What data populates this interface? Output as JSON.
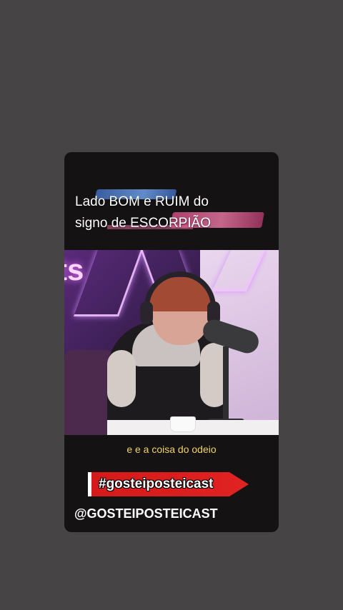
{
  "story": {
    "title_line1": "Lado BOM e RUIM do",
    "title_line2": "signo de ESCORPIÃO",
    "subtitle": "e e a coisa do odeio",
    "hashtag": "#gosteiposteicast",
    "handle": "@GOSTEIPOSTEICAST"
  },
  "colors": {
    "page_bg": "#474446",
    "card_bg": "#141213",
    "subtitle": "#f2d36a",
    "hashtag_bar": "#d41a1a"
  }
}
